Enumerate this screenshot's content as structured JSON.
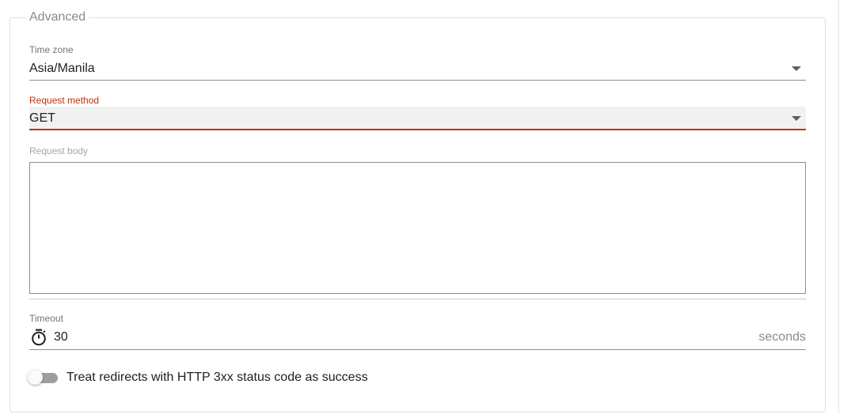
{
  "section": {
    "legend": "Advanced"
  },
  "time_zone": {
    "label": "Time zone",
    "value": "Asia/Manila"
  },
  "request_method": {
    "label": "Request method",
    "value": "GET",
    "accent_color": "#c2300f"
  },
  "request_body": {
    "label": "Request body",
    "value": ""
  },
  "timeout": {
    "label": "Timeout",
    "icon": "stopwatch-icon",
    "value": "30",
    "suffix": "seconds"
  },
  "redirects_toggle": {
    "label": "Treat redirects with HTTP 3xx status code as success",
    "checked": false
  }
}
